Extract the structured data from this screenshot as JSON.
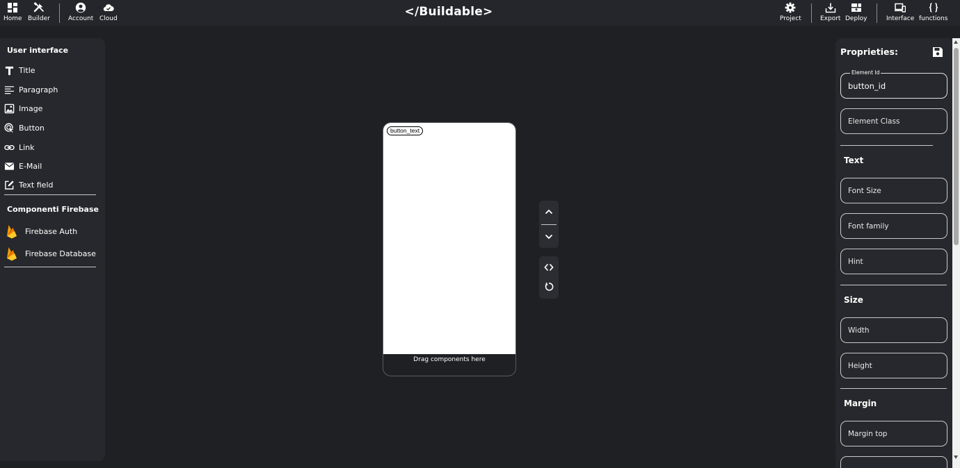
{
  "topbar": {
    "left": [
      {
        "label": "Home",
        "icon": "grid-icon"
      },
      {
        "label": "Builder",
        "icon": "tools-icon"
      },
      {
        "label": "Account",
        "icon": "account-icon"
      },
      {
        "label": "Cloud",
        "icon": "cloud-icon"
      }
    ],
    "logo": "</Buildable>",
    "right": [
      {
        "label": "Project",
        "icon": "gear-icon"
      },
      {
        "label": "Export",
        "icon": "download-icon"
      },
      {
        "label": "Deploy",
        "icon": "deploy-icon"
      },
      {
        "label": "Interface",
        "icon": "devices-icon"
      },
      {
        "label": "functions",
        "icon": "braces-icon"
      }
    ]
  },
  "left_panel": {
    "ui_heading": "User interface",
    "ui_items": [
      {
        "label": "Title",
        "icon": "title-icon"
      },
      {
        "label": "Paragraph",
        "icon": "paragraph-icon"
      },
      {
        "label": "Image",
        "icon": "image-icon"
      },
      {
        "label": "Button",
        "icon": "button-click-icon"
      },
      {
        "label": "Link",
        "icon": "link-icon"
      },
      {
        "label": "E-Mail",
        "icon": "email-icon"
      },
      {
        "label": "Text field",
        "icon": "text-field-icon"
      }
    ],
    "firebase_heading": "Componenti Firebase",
    "firebase_items": [
      {
        "label": "Firebase Auth",
        "icon": "firebase-icon"
      },
      {
        "label": "Firebase Database",
        "icon": "firebase-icon"
      }
    ]
  },
  "canvas": {
    "button_text": "button_text",
    "drop_hint": "Drag components here"
  },
  "properties": {
    "title": "Proprieties:",
    "element_id_legend": "Element Id",
    "element_id_value": "button_id",
    "element_class_placeholder": "Element Class",
    "text_heading": "Text",
    "font_size_placeholder": "Font Size",
    "font_family_placeholder": "Font family",
    "hint_placeholder": "Hint",
    "size_heading": "Size",
    "width_placeholder": "Width",
    "height_placeholder": "Height",
    "margin_heading": "Margin",
    "margin_top_placeholder": "Margin top"
  },
  "colors": {
    "background": "#1f2024",
    "topbar": "#25262b",
    "panel": "#27282d",
    "firebase_yellow": "#ffca28",
    "firebase_orange": "#f57c00"
  }
}
